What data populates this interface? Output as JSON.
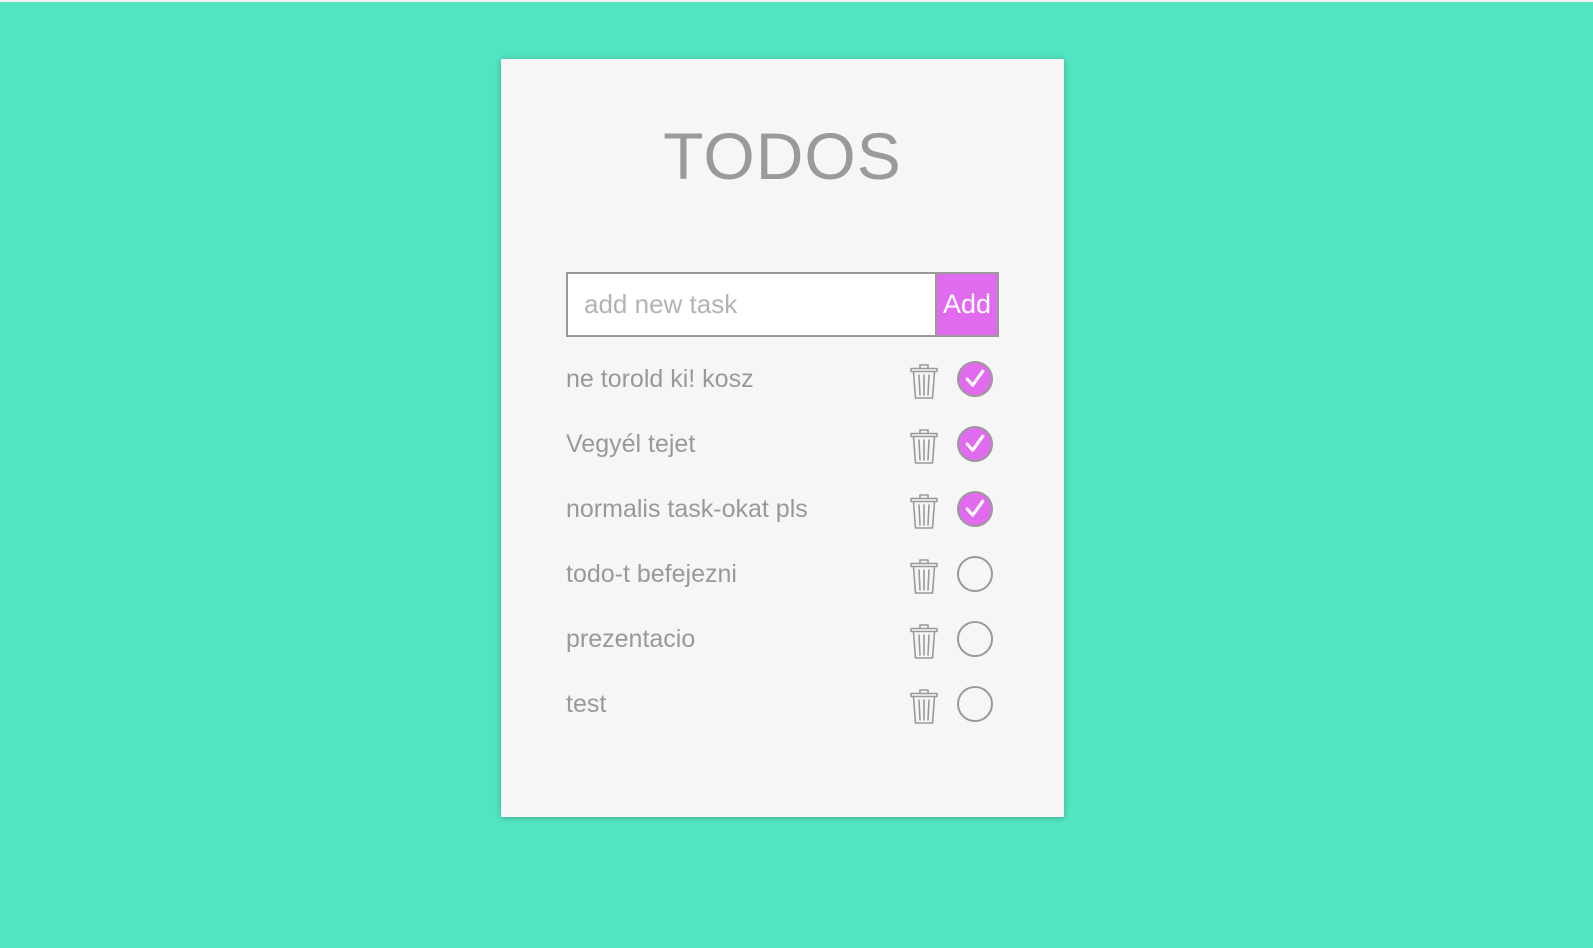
{
  "app": {
    "title": "TODOS"
  },
  "add_form": {
    "placeholder": "add new task",
    "value": "",
    "add_label": "Add"
  },
  "tasks": [
    {
      "label": "ne torold ki! kosz",
      "done": true
    },
    {
      "label": "Vegyél tejet",
      "done": true
    },
    {
      "label": "normalis task-okat pls",
      "done": true
    },
    {
      "label": "todo-t befejezni",
      "done": false
    },
    {
      "label": "prezentacio",
      "done": false
    },
    {
      "label": "test",
      "done": false
    }
  ],
  "icons": {
    "delete": "trash-icon",
    "complete": "checkmark-icon"
  },
  "colors": {
    "background": "#52e5c2",
    "card": "#f6f6f6",
    "accent": "#e06bee",
    "text": "#999999"
  }
}
